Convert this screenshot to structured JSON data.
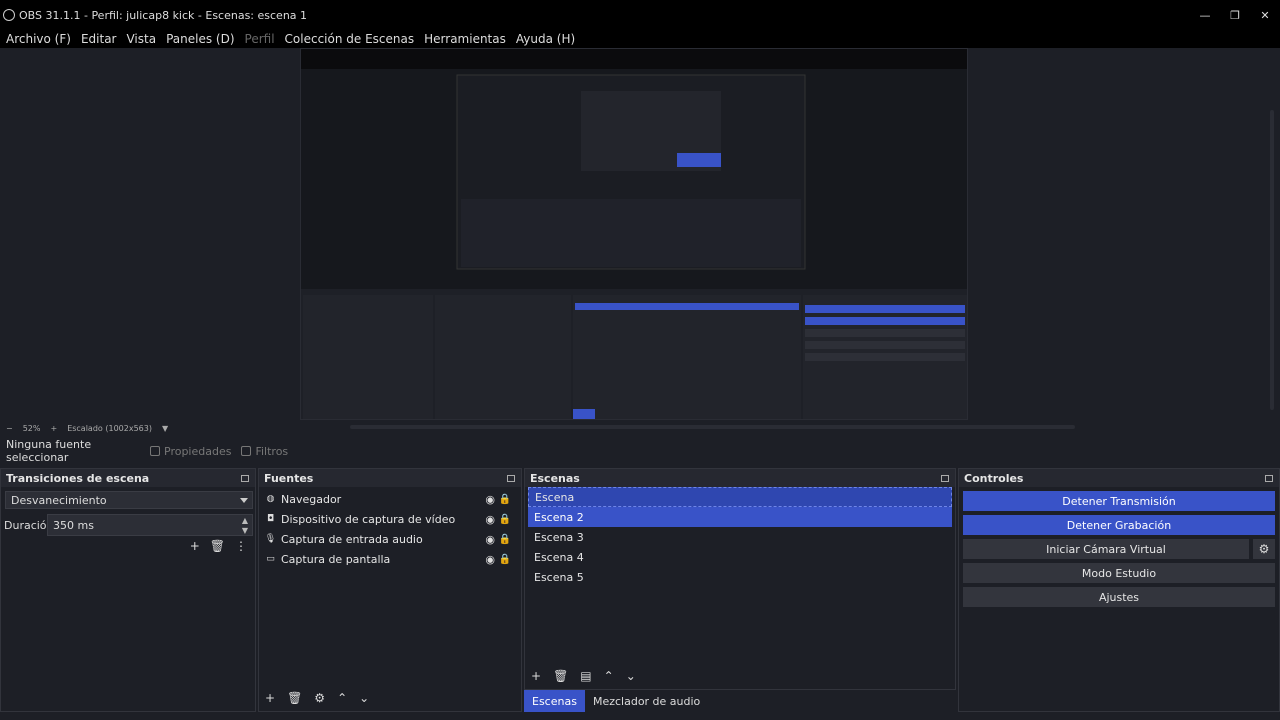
{
  "window": {
    "title": "OBS 31.1.1 - Perfil: julicap8 kick - Escenas: escena 1"
  },
  "menu": [
    {
      "label": "Archivo (F)",
      "disabled": false
    },
    {
      "label": "Editar",
      "disabled": false
    },
    {
      "label": "Vista",
      "disabled": false
    },
    {
      "label": "Paneles (D)",
      "disabled": false
    },
    {
      "label": "Perfil",
      "disabled": true
    },
    {
      "label": "Colección de Escenas",
      "disabled": false
    },
    {
      "label": "Herramientas",
      "disabled": false
    },
    {
      "label": "Ayuda (H)",
      "disabled": false
    }
  ],
  "zoom": {
    "minus": "−",
    "value": "52%",
    "plus": "+",
    "mode": "Escalado (1002x563)"
  },
  "source_bar": {
    "none_selected": "Ninguna fuente seleccionar",
    "properties": "Propiedades",
    "filters": "Filtros"
  },
  "transitions": {
    "title": "Transiciones de escena",
    "selected": "Desvanecimiento",
    "duration_label": "Duración",
    "duration_value": "350 ms"
  },
  "sources": {
    "title": "Fuentes",
    "items": [
      {
        "label": "Navegador",
        "icon": "globe-icon"
      },
      {
        "label": "Dispositivo de captura de vídeo",
        "icon": "camera-icon"
      },
      {
        "label": "Captura de entrada audio",
        "icon": "microphone-icon"
      },
      {
        "label": "Captura de pantalla",
        "icon": "monitor-icon"
      }
    ]
  },
  "scenes": {
    "title": "Escenas",
    "items": [
      {
        "label": "Escena",
        "state": "editing"
      },
      {
        "label": "Escena 2",
        "state": "selected"
      },
      {
        "label": "Escena 3",
        "state": ""
      },
      {
        "label": "Escena 4",
        "state": ""
      },
      {
        "label": "Escena 5",
        "state": ""
      }
    ]
  },
  "tabs": [
    {
      "label": "Escenas",
      "active": true
    },
    {
      "label": "Mezclador de audio",
      "active": false
    }
  ],
  "controls": {
    "title": "Controles",
    "stop_stream": "Detener Transmisión",
    "stop_record": "Detener Grabación",
    "virtual_cam": "Iniciar Cámara Virtual",
    "studio_mode": "Modo Estudio",
    "settings": "Ajustes"
  },
  "colors": {
    "accent": "#3953c8",
    "panel": "#262830",
    "background": "#1d1f26"
  }
}
